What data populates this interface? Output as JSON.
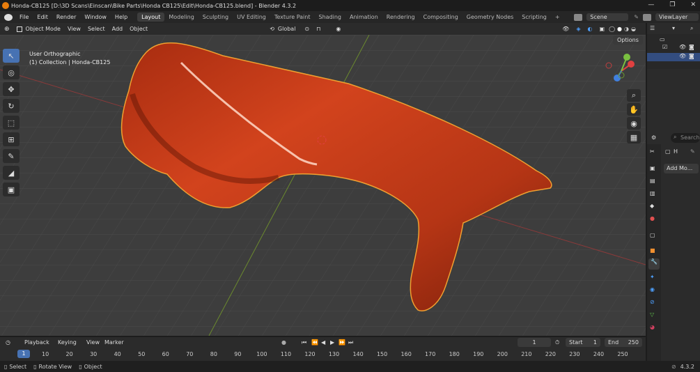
{
  "window": {
    "title": "Honda-CB125 [D:\\3D Scans\\Einscan\\Bike Parts\\Honda CB125\\Edit\\Honda-CB125.blend] - Blender 4.3.2",
    "controls": [
      "—",
      "❐",
      "✕"
    ]
  },
  "menu": {
    "items": [
      "File",
      "Edit",
      "Render",
      "Window",
      "Help"
    ]
  },
  "workspaces": {
    "tabs": [
      "Layout",
      "Modeling",
      "Sculpting",
      "UV Editing",
      "Texture Paint",
      "Shading",
      "Animation",
      "Rendering",
      "Compositing",
      "Geometry Nodes",
      "Scripting"
    ],
    "active": "Layout",
    "add": "+"
  },
  "scene": {
    "name": "Scene",
    "view_layer": "ViewLayer"
  },
  "viewport_header": {
    "mode": "Object Mode",
    "menus": [
      "View",
      "Select",
      "Add",
      "Object"
    ],
    "transform_orientation": "Global",
    "options_label": "Options"
  },
  "viewport_info": {
    "view": "User Orthographic",
    "collection": "(1) Collection | Honda-CB125"
  },
  "properties": {
    "object_letter": "H",
    "add_modifier": "Add Mo...",
    "search": "Search"
  },
  "timeline": {
    "menus": [
      "Playback",
      "Keying",
      "View",
      "Marker"
    ],
    "current_frame": "1",
    "start_label": "Start",
    "start": "1",
    "end_label": "End",
    "end": "250",
    "ruler": [
      "1",
      "10",
      "20",
      "30",
      "40",
      "50",
      "60",
      "70",
      "80",
      "90",
      "100",
      "110",
      "120",
      "130",
      "140",
      "150",
      "160",
      "170",
      "180",
      "190",
      "200",
      "210",
      "220",
      "230",
      "240",
      "250"
    ]
  },
  "status": {
    "select": "Select",
    "rotate": "Rotate View",
    "object": "Object",
    "version": "4.3.2"
  },
  "colors": {
    "accent": "#4772b3",
    "selection_outline": "#f0a030",
    "object": "#c4391a"
  }
}
